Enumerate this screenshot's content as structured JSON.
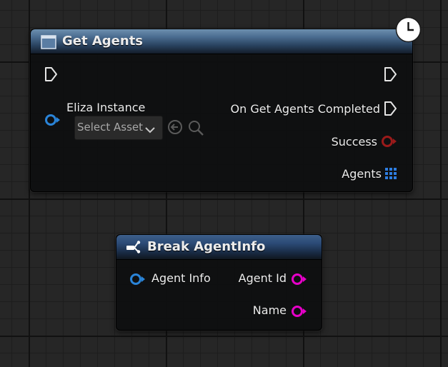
{
  "get_agents_node": {
    "title": "Get Agents",
    "input_pin_label": "Eliza Instance",
    "asset_picker": {
      "value": "Select Asset"
    },
    "outputs": [
      {
        "label": "On Get Agents Completed",
        "pin": "exec"
      },
      {
        "label": "Success",
        "pin": "bool"
      },
      {
        "label": "Agents",
        "pin": "array"
      }
    ],
    "latent_badge_icon": "clock-icon",
    "header_icon": "function-icon"
  },
  "break_node": {
    "title": "Break AgentInfo",
    "input_pin_label": "Agent Info",
    "outputs": [
      {
        "label": "Agent Id"
      },
      {
        "label": "Name"
      }
    ],
    "header_icon": "break-struct-icon"
  },
  "colors": {
    "exec_pin": "#e6e6e6",
    "struct_pin": "#2a84d8",
    "bool_pin": "#9a1a1a",
    "string_pin": "#e600c8",
    "array_pin": "#2e7de0"
  }
}
